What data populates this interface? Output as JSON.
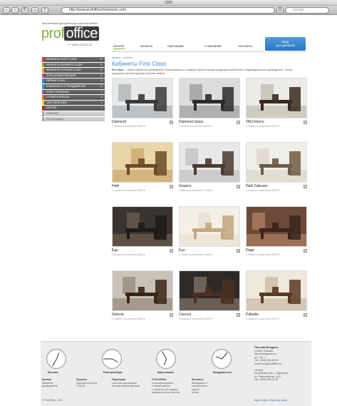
{
  "window": {
    "title": "1280"
  },
  "toolbar": {
    "url": "http://www.profofficeshowroom.com/",
    "search_placeholder": "Google"
  },
  "header": {
    "tagline": "эксклюзивные дистрибьюторы офисной мебели",
    "logo_left": "prof",
    "logo_right": "office",
    "phone": "+7 (495) 925-30-30",
    "nav": [
      "каталог",
      "проекты",
      "партнерам",
      "о компании",
      "контакты"
    ],
    "dealer_line1": "вход",
    "dealer_line2": "для дилеров"
  },
  "sidebar": {
    "items": [
      {
        "label": "КАБИНЕТЫ FIRST CLASS",
        "count": "29",
        "color": "#e8302c"
      },
      {
        "label": "КАБИНЕТЫ BUSINESS CLASS",
        "count": "16",
        "color": "#7fb035"
      },
      {
        "label": "КАБИНЕТЫ ECONOM CLASS",
        "count": "10",
        "color": "#f2a11e"
      },
      {
        "label": "ЗОНЫ КОММУНИКАЦИЙ",
        "count": "10",
        "color": "#e83a8c"
      },
      {
        "label": "ПЕРВЫЕ ЗОНЫ",
        "count": "8",
        "color": "#3b8ad6"
      },
      {
        "label": "КОНЬЮНКТЫ И ПЕРЕДВИЖНЫЕ",
        "count": "10",
        "color": "#2ab0b0"
      },
      {
        "label": "ЗОНЫ ПРИЕМНОЙ",
        "count": "9",
        "color": "#8a4fc6"
      },
      {
        "label": "СТУЛЬЯ И КРЕСЛА",
        "count": "9",
        "color": "#e86d1e"
      },
      {
        "label": "СВЕТОВОЙ СВЕТ",
        "count": "8",
        "color": "#f2d21e"
      },
      {
        "label": "ПРОЧЕЕ",
        "count": "0",
        "color": "#cc2222"
      },
      {
        "label": "НОВИНКИ",
        "count": "",
        "color": "#aaaaaa"
      },
      {
        "label": "РАСПРОДАЖА",
        "count": "",
        "color": "#aaaaaa"
      }
    ]
  },
  "main": {
    "breadcrumb_link": "Каталог",
    "breadcrumb_rest": " › Кабинет",
    "title": "Кабинеты First Class",
    "description_bold": "first class",
    "description": " — штиль кабинетов руководителя. Эксклюзивность и комфорт. Демонстрация продукции в кабинетах и индивидуальность руководителя. Статус подчеркнут архитектурными линиями мебели.",
    "products": [
      {
        "name": "Diamond",
        "price": "Стоимость комплекта 6550 €"
      },
      {
        "name": "Diamond Glass",
        "price": "Стоимость комплекта 6810 €"
      },
      {
        "name": "TAO Ebony",
        "price": "Стоимость комплекта 6400 €"
      },
      {
        "name": "Hahl",
        "price": "Стоимость комплекта 6851 €"
      },
      {
        "name": "Gropius",
        "price": "Стоимость комплекта 7515 €"
      },
      {
        "name": "Hahl Zebrano",
        "price": "Стоимость комплекта 8560 €"
      },
      {
        "name": "Ego",
        "price": "Стоимость комплекта 5619 €"
      },
      {
        "name": "Kyo",
        "price": "Стоимость комплекта 9500 €"
      },
      {
        "name": "Doge",
        "price": "Стоимость комплекта 5519 €"
      },
      {
        "name": "Selecta",
        "price": "Стоимость комплекта 6200 €"
      },
      {
        "name": "Canova",
        "price": "Стоимость комплекта 6080 €"
      },
      {
        "name": "Palladio",
        "price": "Стоимость комплекта 6140 €"
      }
    ]
  },
  "footer": {
    "cities": [
      "Москва",
      "Екатеринбург",
      "Красноярск",
      "Владивосток"
    ],
    "columns": [
      {
        "title": "Каталог",
        "lines": [
          "кабинеты",
          "руководителя"
        ]
      },
      {
        "title": "Проекты",
        "lines": [
          "Газпром проектов",
          "ТЭЦ-16"
        ]
      },
      {
        "title": "Партнерам",
        "lines": [
          "участник партнерами",
          "личный кабинет дилера"
        ]
      },
      {
        "title": "О ProfOffice",
        "lines": [
          "о компании кратко",
          "о нашей работе",
          "о клиентах об отзывах",
          "подписаться на новости"
        ]
      },
      {
        "title": "Контакты",
        "lines": [
          "менеджеры и",
          "консультанты",
          "ход на",
          "отзыв"
        ]
      }
    ],
    "address_title": "Почтовый адрес:",
    "address_lines": [
      "123022, Москва,",
      "Звенигородская ул.,",
      "д.2, стр. 1",
      "тел.: (495) 925-30-30",
      "email: info@profoffice.ru",
      "",
      "СКЛАД",
      "Московская обл., г.Одинцово,",
      "ул. Транспортная, д.10",
      "тел.: (495) 925-20-20"
    ],
    "copyright": "© ProfOffice, 2011",
    "links": "Карта сайта   Обратная связь"
  },
  "colors": {
    "accent_green": "#7fb035",
    "accent_blue": "#2a74c0"
  }
}
